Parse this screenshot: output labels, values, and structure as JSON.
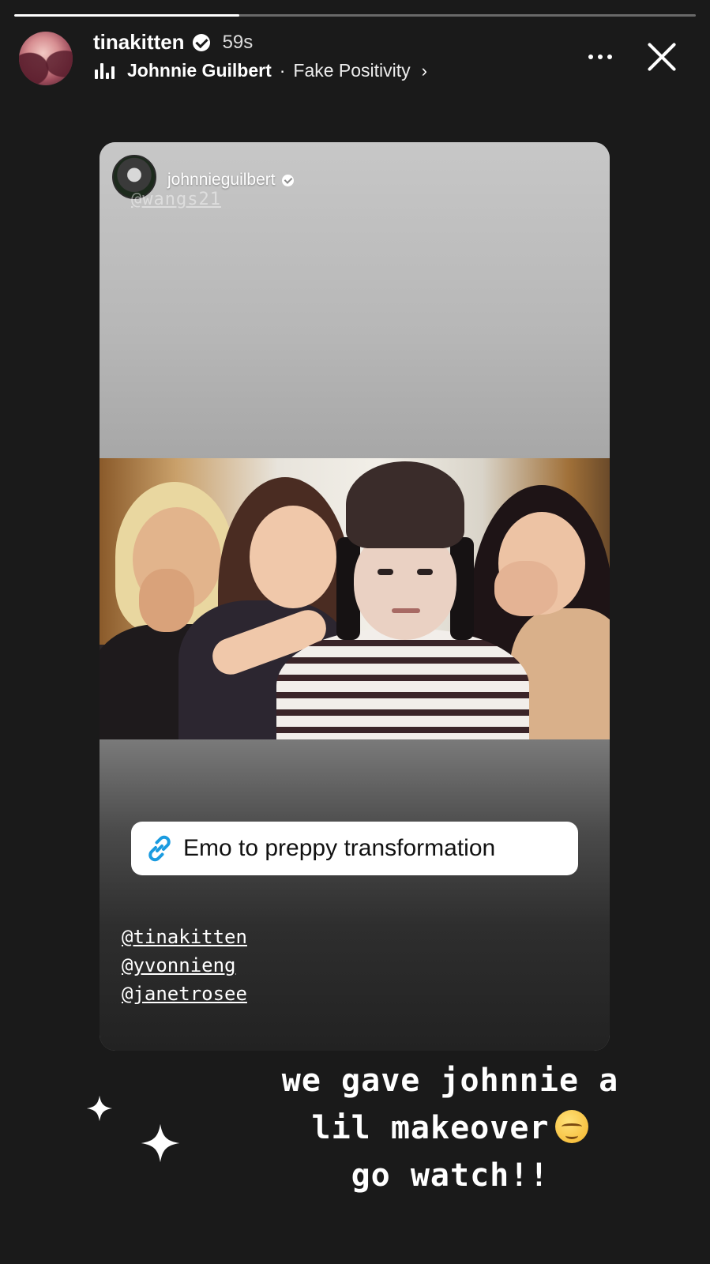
{
  "progress": {
    "fraction": 0.33
  },
  "header": {
    "username": "tinakitten",
    "timestamp": "59s",
    "music": {
      "artist": "Johnnie Guilbert",
      "separator": "·",
      "song": "Fake Positivity",
      "chevron": "›"
    },
    "more_icon": "more-horizontal-icon",
    "close_icon": "close-icon"
  },
  "shared_post": {
    "username": "johnnieguilbert",
    "ghost_tag": "@wangs21",
    "link_sticker": {
      "label": "Emo to preppy transformation",
      "icon": "link-icon",
      "icon_color": "#1a9be0"
    },
    "mentions": [
      "@tinakitten",
      "@yvonnieng",
      "@janetrosee"
    ]
  },
  "caption": {
    "line1": "we gave johnnie a",
    "line2": "lil makeover",
    "line3": "go watch!!",
    "emoji": "pensive-face-emoji"
  },
  "colors": {
    "background": "#1a1a1a",
    "text": "#ffffff",
    "link_blue": "#1a9be0"
  }
}
